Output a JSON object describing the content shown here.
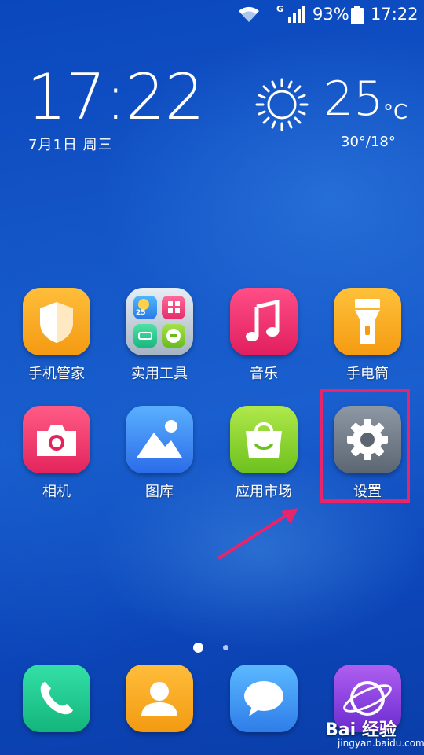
{
  "status_bar": {
    "network_type": "G",
    "battery_percent": "93%",
    "time": "17:22",
    "icons": [
      "wifi-icon",
      "signal-icon",
      "battery-icon"
    ]
  },
  "clock_widget": {
    "time": "17:22",
    "date": "7月1日 周三"
  },
  "weather_widget": {
    "icon": "sun-icon",
    "temperature": "25",
    "unit": "°C",
    "range": "30°/18°"
  },
  "apps": [
    {
      "label": "手机管家",
      "icon": "shield-icon"
    },
    {
      "label": "实用工具",
      "icon": "tools-folder-icon"
    },
    {
      "label": "音乐",
      "icon": "music-note-icon"
    },
    {
      "label": "手电筒",
      "icon": "flashlight-icon"
    },
    {
      "label": "相机",
      "icon": "camera-icon"
    },
    {
      "label": "图库",
      "icon": "gallery-icon"
    },
    {
      "label": "应用市场",
      "icon": "shopping-bag-icon"
    },
    {
      "label": "设置",
      "icon": "gear-icon"
    }
  ],
  "tools_folder_mini": {
    "weather_text": "25"
  },
  "page_indicator": {
    "pages": 2,
    "current": 1
  },
  "dock": [
    {
      "icon": "phone-icon"
    },
    {
      "icon": "contacts-icon"
    },
    {
      "icon": "messages-icon"
    },
    {
      "icon": "browser-icon"
    }
  ],
  "annotation": {
    "highlight_color": "#e8246b",
    "target": "设置"
  },
  "watermark": {
    "brand": "Bai 经验",
    "url": "jingyan.baidu.com"
  }
}
